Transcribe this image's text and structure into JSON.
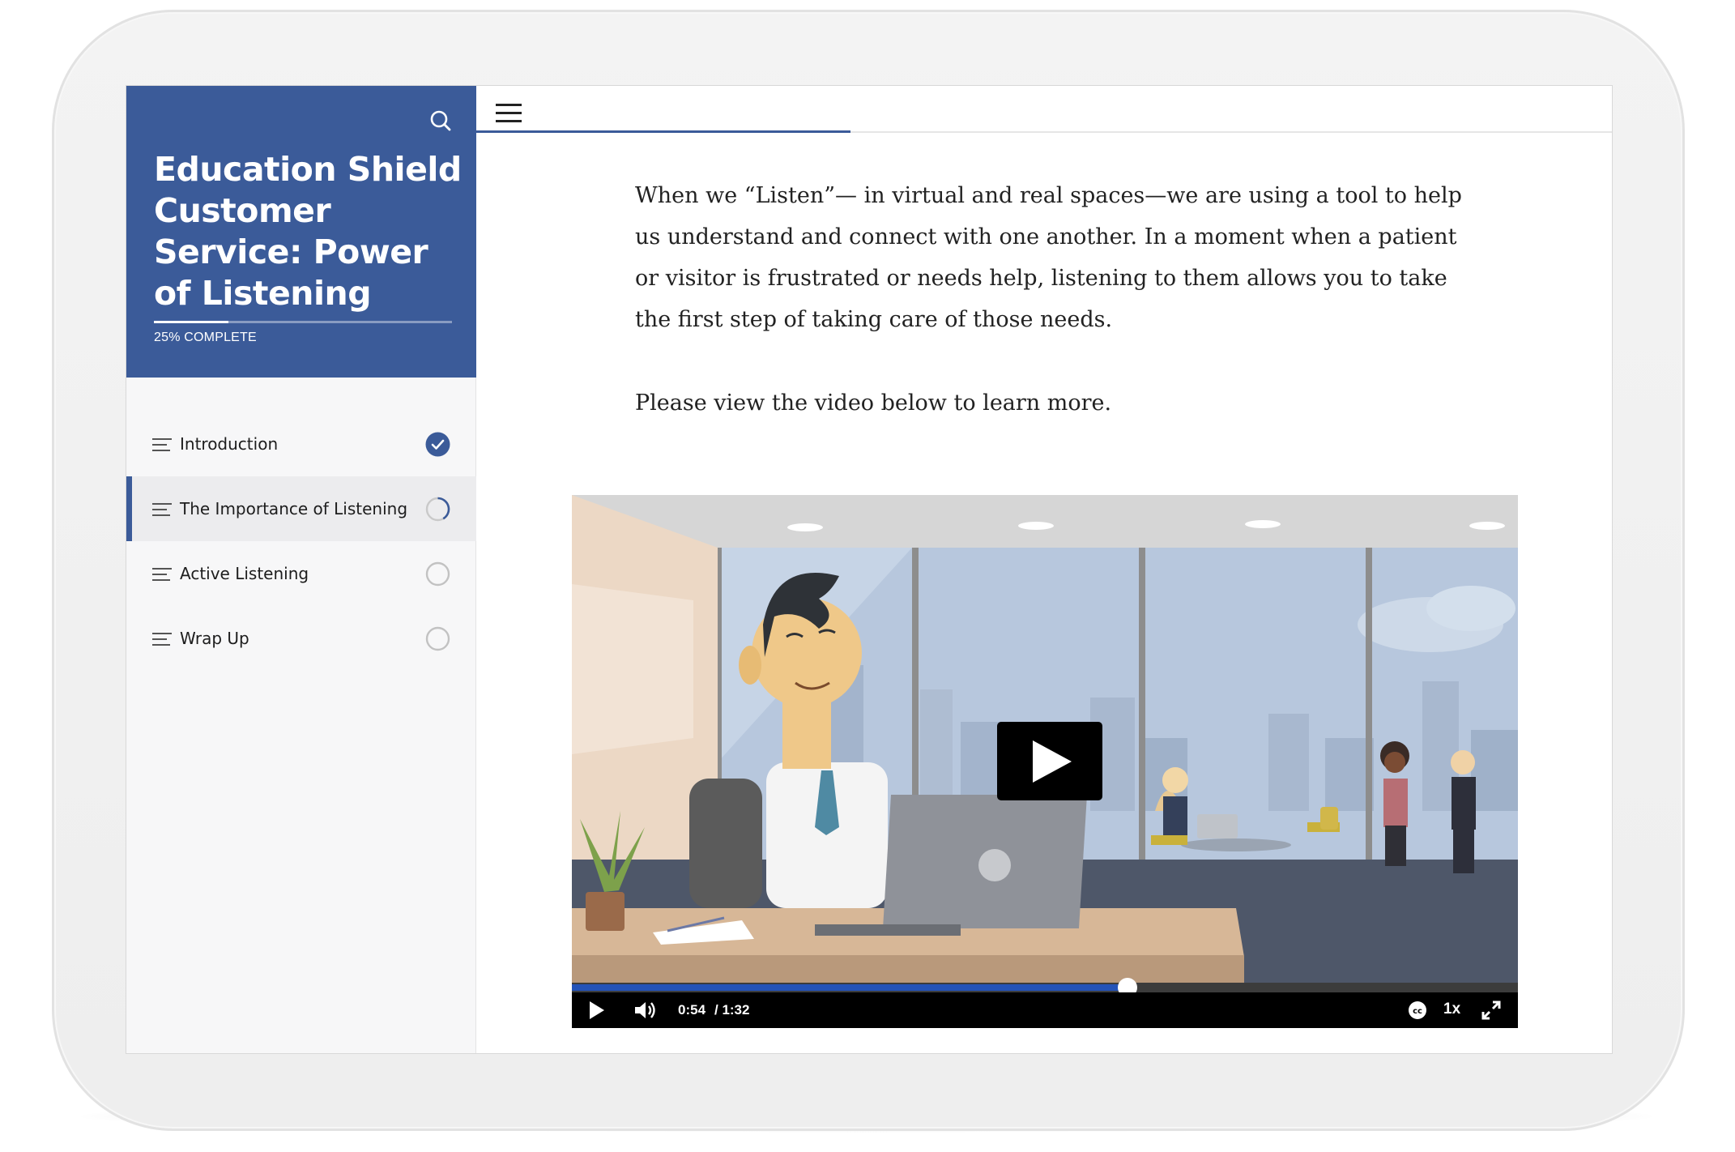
{
  "course": {
    "title": "Education Shield Customer Service: Power of Listening",
    "progress_percent": 25,
    "progress_label": "25% COMPLETE"
  },
  "lessons": [
    {
      "label": "Introduction",
      "status": "complete"
    },
    {
      "label": "The Importance of Listening",
      "status": "in-progress",
      "active": true
    },
    {
      "label": "Active Listening",
      "status": "not-started"
    },
    {
      "label": "Wrap Up",
      "status": "not-started"
    }
  ],
  "content": {
    "paragraph1": "When we “Listen”— in virtual and real spaces—we are using a tool to help us understand and connect with one another. In a moment when a patient or visitor is frustrated or needs help, listening to them allows you to take the first step of taking care of those needs.",
    "paragraph2": "Please view the video below to learn more."
  },
  "video": {
    "current_time": "0:54",
    "duration": "/ 1:32",
    "playback_fraction": 0.587,
    "speed": "1x"
  },
  "colors": {
    "accent": "#3b5b99",
    "video_progress": "#2453b8"
  },
  "icons": [
    "search-icon",
    "menu-lines-icon",
    "check-circle-icon",
    "progress-ring-icon",
    "empty-circle-icon",
    "hamburger-icon",
    "play-icon",
    "volume-icon",
    "closed-captions-icon",
    "fullscreen-icon"
  ]
}
